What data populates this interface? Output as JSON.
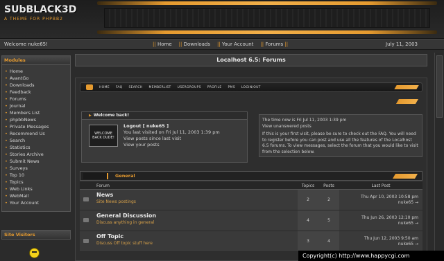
{
  "header": {
    "logo_title": "SUbBLACK3D",
    "logo_subtitle": "A THEME FOR PHPBB2"
  },
  "navbar": {
    "welcome": "Welcome nuke65!",
    "links": [
      "Home",
      "Downloads",
      "Your Account",
      "Forums"
    ],
    "date": "July 11, 2003"
  },
  "sidebar": {
    "modules_title": "Modules",
    "modules": [
      "Home",
      "AvantGo",
      "Downloads",
      "Feedback",
      "Forums",
      "Journal",
      "Members List",
      "phpbbNews",
      "Private Messages",
      "Recommend Us",
      "Search",
      "Statistics",
      "Stories Archive",
      "Submit News",
      "Surveys",
      "Top 10",
      "Topics",
      "Web Links",
      "WebMail",
      "Your Account"
    ],
    "visitors_title": "Site Visitors"
  },
  "main": {
    "title": "Localhost 6.5: Forums",
    "tabs": [
      "HOME",
      "FAQ",
      "SEARCH",
      "MEMBERLIST",
      "USERGROUPS",
      "PROFILE",
      "PMS",
      "LOGIN/OUT"
    ],
    "welcome": {
      "title": "Welcome back!",
      "badge": "WELCOME BACK DUDE!",
      "logout": "Logout [ nuke65 ]",
      "last_visit": "You last visited on Fri Jul 11, 2003 1:39 pm",
      "posts_since": "View posts since last visit",
      "your_posts": "View your posts"
    },
    "time_panel": {
      "now": "The time now is Fri Jul 11, 2003 1:39 pm",
      "unanswered": "View unanswered posts",
      "info": "If this is your first visit, please be sure to check out the FAQ. You will need to register before you can post and use all the features of the Localhost 6.5 forums. To view messages, select the forum that you would like to visit from the selection below."
    },
    "category": "General",
    "table_headers": {
      "forum": "Forum",
      "topics": "Topics",
      "posts": "Posts",
      "last_post": "Last Post"
    },
    "forums": [
      {
        "name": "News",
        "desc": "Site News postings",
        "topics": "2",
        "posts": "2",
        "last_date": "Thu Apr 10, 2003 10:58 pm",
        "last_user": "nuke65 →"
      },
      {
        "name": "General Discussion",
        "desc": "Discuss anything in general",
        "topics": "4",
        "posts": "5",
        "last_date": "Thu Jun 26, 2003 12:10 pm",
        "last_user": "nuke65 →"
      },
      {
        "name": "Off Topic",
        "desc": "Discuss Off topic stuff here",
        "topics": "3",
        "posts": "4",
        "last_date": "Thu Jun 12, 2003 9:50 am",
        "last_user": "nuke65 →"
      }
    ]
  },
  "watermark": "Copyright(c) http://www.happycgi.com",
  "colors": {
    "accent": "#e59a2f",
    "background": "#2b2b2b",
    "panel": "#3a3a3a"
  }
}
